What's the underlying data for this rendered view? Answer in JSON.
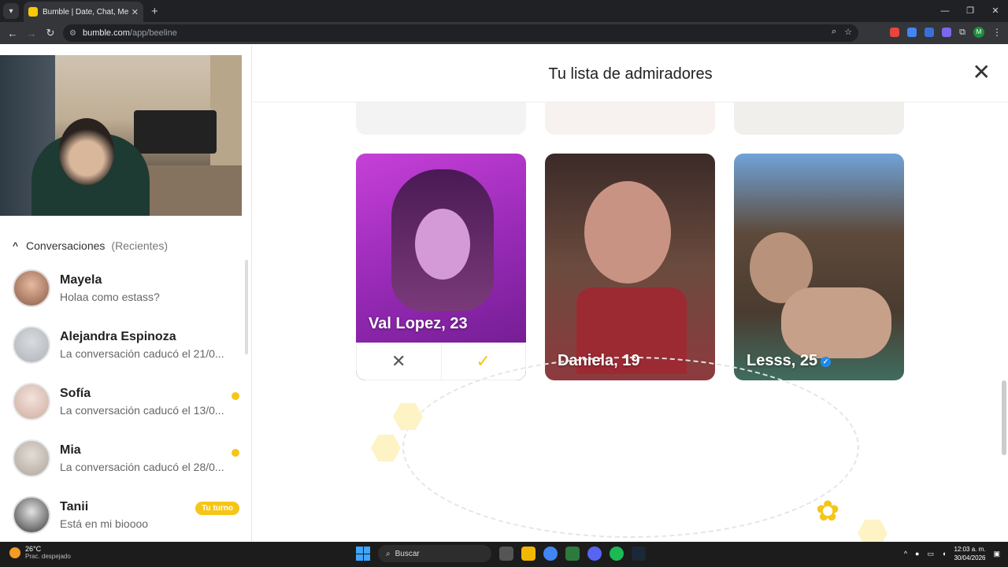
{
  "browser": {
    "tab_title": "Bumble | Date, Chat, Meet New",
    "url_host": "bumble.com",
    "url_path": "/app/beeline"
  },
  "sidebar": {
    "conversations_title": "Conversaciones",
    "conversations_filter": "(Recientes)",
    "items": [
      {
        "name": "Mayela",
        "message": "Holaa como estass?",
        "indicator": "none"
      },
      {
        "name": "Alejandra Espinoza",
        "message": "La conversación caducó el 21/0...",
        "indicator": "none"
      },
      {
        "name": "Sofía",
        "message": "La conversación caducó el 13/0...",
        "indicator": "dot"
      },
      {
        "name": "Mia",
        "message": "La conversación caducó el 28/0...",
        "indicator": "dot"
      },
      {
        "name": "Tanii",
        "message": "Está en mi bioooo",
        "indicator": "badge",
        "badge": "Tu turno"
      }
    ]
  },
  "main": {
    "title": "Tu lista de admiradores",
    "profiles": [
      {
        "label": "Val Lopez, 23"
      },
      {
        "label": "Daniela, 19"
      },
      {
        "label": "Lesss, 25",
        "verified": true
      }
    ]
  },
  "taskbar": {
    "temperature": "26°C",
    "weather": "Prac. despejado",
    "search_placeholder": "Buscar",
    "time": "12:03 a. m.",
    "date": "30/04/2026"
  },
  "colors": {
    "accent": "#f5c518",
    "chrome_dark": "#202124",
    "verified": "#1c8ef5"
  }
}
